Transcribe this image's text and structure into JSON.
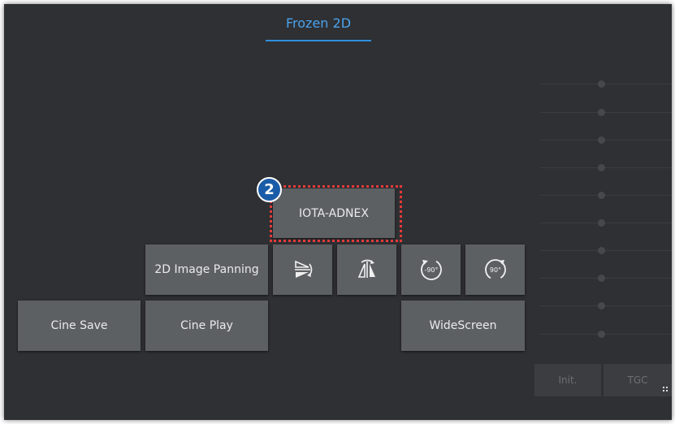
{
  "header": {
    "title": "Frozen 2D"
  },
  "badge": {
    "number": "2"
  },
  "buttons": {
    "iota_adnex": "IOTA-ADNEX",
    "image_panning": "2D Image Panning",
    "cine_save": "Cine Save",
    "cine_play": "Cine Play",
    "widescreen": "WideScreen",
    "rotate_left": "-90°",
    "rotate_right": "90°"
  },
  "icons": {
    "flip_horizontal": "flip-horizontal-icon",
    "flip_vertical": "flip-vertical-icon",
    "rotate_left": "rotate-left-icon",
    "rotate_right": "rotate-right-icon"
  },
  "tgc": {
    "init_label": "Init.",
    "tgc_label": "TGC",
    "slider_count": 10
  },
  "colors": {
    "background": "#2f3033",
    "button": "#5d6063",
    "accent": "#4aa3ee",
    "highlight": "#e83a3a",
    "badge": "#1a5ca8"
  }
}
